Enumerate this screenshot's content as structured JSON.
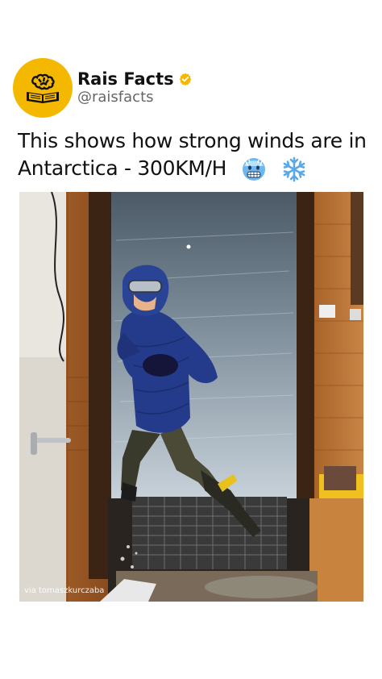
{
  "post": {
    "author_name": "Rais Facts",
    "author_handle": "@raisfacts",
    "caption_text": "This shows how strong winds are in Antarctica - 300KM/H",
    "verified": true,
    "watermark": "via tomaszkurczaba",
    "colors": {
      "avatar_bg": "#F5B800",
      "verified_badge": "#F5B800"
    },
    "icons": [
      "book-brain-logo-icon",
      "verified-badge-icon",
      "freezing-face-emoji-icon",
      "snowflake-emoji-icon"
    ]
  }
}
